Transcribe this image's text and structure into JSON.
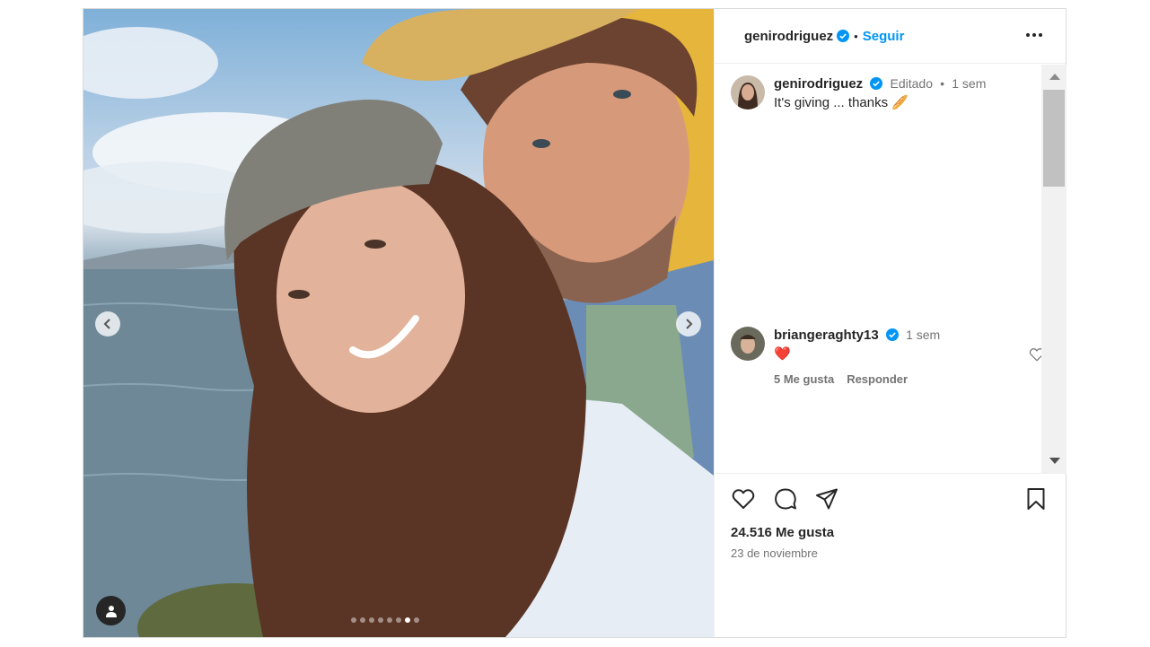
{
  "post": {
    "carousel": {
      "dot_count": 8,
      "active_index": 6
    }
  },
  "header": {
    "username": "genirodriguez",
    "separator": "•",
    "follow_label": "Seguir"
  },
  "caption": {
    "username": "genirodriguez",
    "edited_label": "Editado",
    "separator": "•",
    "time": "1 sem",
    "text": "It's giving ... thanks 🥖"
  },
  "comments": [
    {
      "username": "briangeraghty13",
      "time": "1 sem",
      "text": "❤️",
      "likes_label": "5 Me gusta",
      "reply_label": "Responder"
    }
  ],
  "footer": {
    "likes": "24.516 Me gusta",
    "date": "23 de noviembre"
  },
  "colors": {
    "accent": "#0095f6",
    "verified": "#0095f6",
    "text": "#262626",
    "muted": "#737373",
    "heart_red": "#ed2f40"
  },
  "icons": [
    "chevron-left-icon",
    "chevron-right-icon",
    "user-tag-icon",
    "verified-icon",
    "more-options-icon",
    "heart-icon",
    "comment-icon",
    "share-icon",
    "bookmark-icon"
  ]
}
